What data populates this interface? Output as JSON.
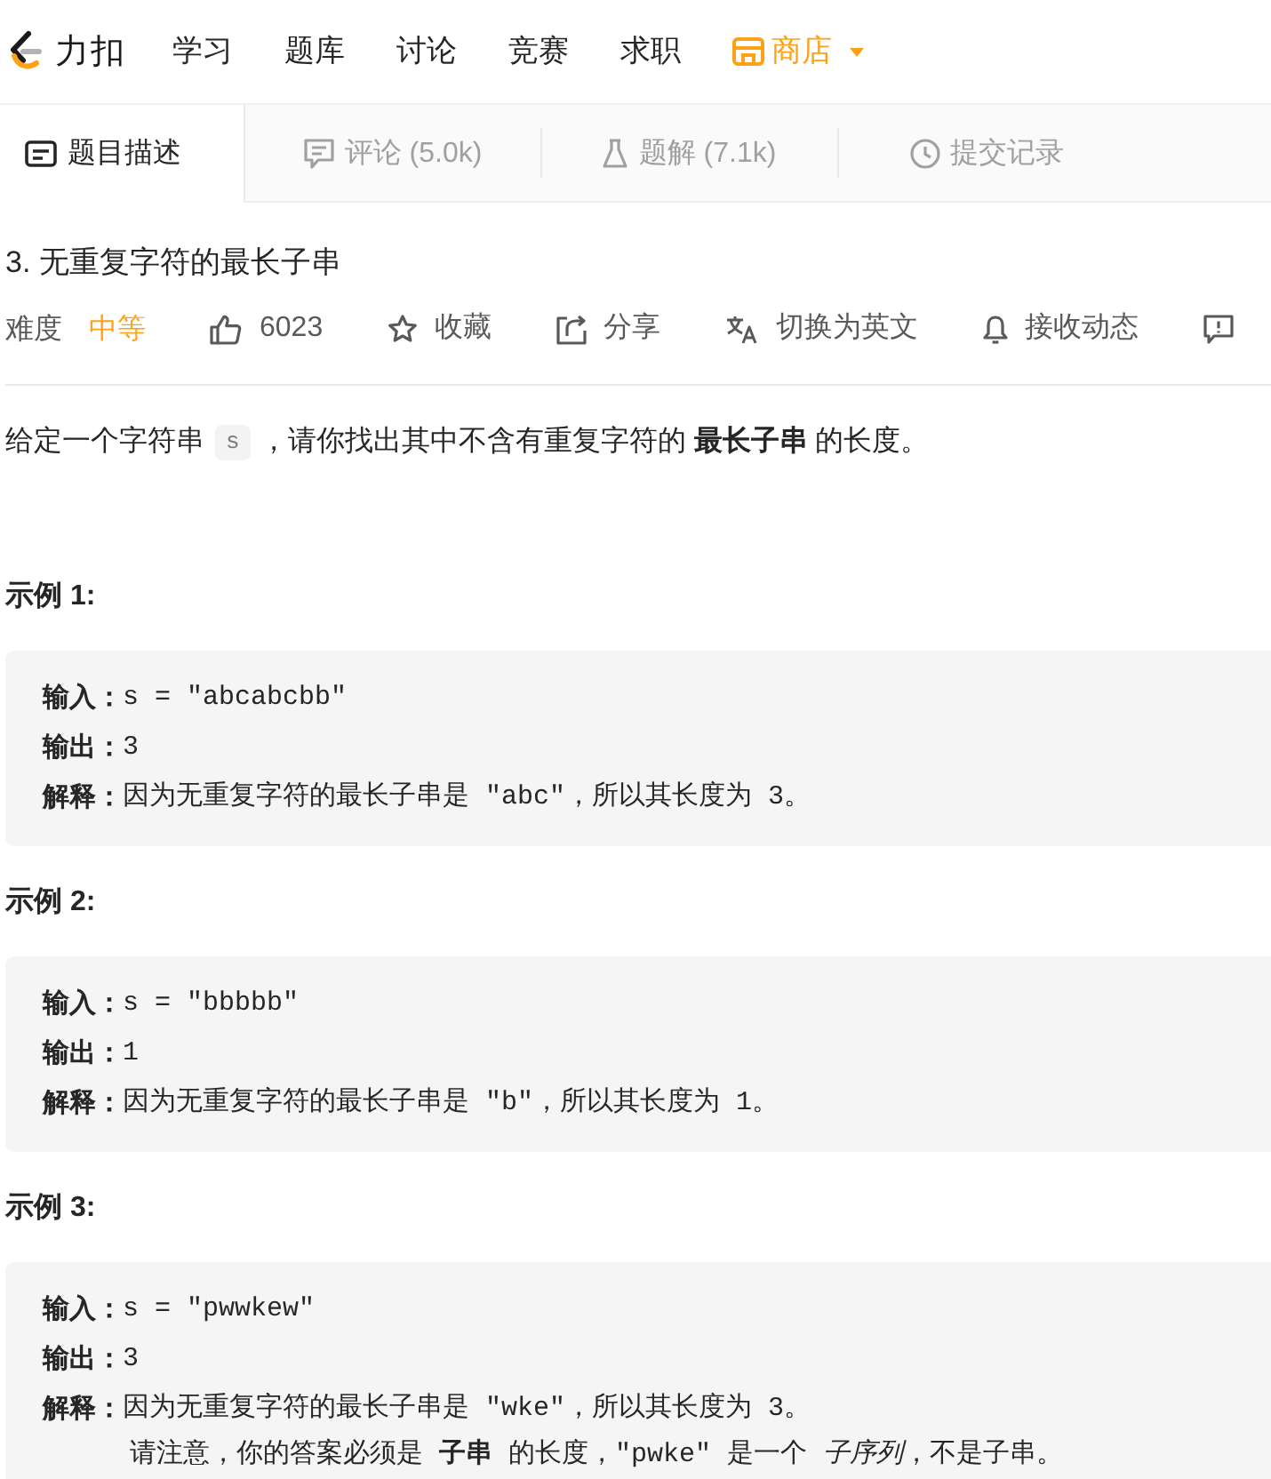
{
  "nav": {
    "brand": "力扣",
    "links": [
      {
        "label": "学习",
        "kind": "link"
      },
      {
        "label": "题库",
        "kind": "link"
      },
      {
        "label": "讨论",
        "kind": "link"
      },
      {
        "label": "竞赛",
        "kind": "link"
      },
      {
        "label": "求职",
        "kind": "link"
      },
      {
        "label": "商店",
        "kind": "store"
      }
    ]
  },
  "tabs": [
    {
      "label": "题目描述",
      "kind": "description",
      "selected": true
    },
    {
      "label": "评论 (5.0k)",
      "kind": "comments",
      "selected": false
    },
    {
      "label": "题解 (7.1k)",
      "kind": "solutions",
      "selected": false
    },
    {
      "label": "提交记录",
      "kind": "submissions",
      "selected": false
    }
  ],
  "problem": {
    "title": "3. 无重复字符的最长子串",
    "difficulty_label": "难度",
    "difficulty": "中等",
    "actions": [
      {
        "kind": "like",
        "label": "6023"
      },
      {
        "kind": "star",
        "label": "收藏"
      },
      {
        "kind": "share",
        "label": "分享"
      },
      {
        "kind": "translate",
        "label": "切换为英文"
      },
      {
        "kind": "bell",
        "label": "接收动态"
      },
      {
        "kind": "feedback"
      }
    ]
  },
  "description": {
    "before": "给定一个字符串",
    "code": "s",
    "after": "，请你找出其中不含有重复字符的 **最长子串** 的长度。"
  },
  "examples": [
    {
      "title": "示例 1:",
      "lines": [
        {
          "kind": "line",
          "label": "输入：",
          "text": "s = \"abcabcbb\""
        },
        {
          "kind": "line",
          "label": "输出：",
          "text": "3"
        },
        {
          "kind": "line",
          "label": "解释：",
          "text": "因为无重复字符的最长子串是 \"abc\"，所以其长度为 3。"
        }
      ]
    },
    {
      "title": "示例 2:",
      "lines": [
        {
          "kind": "line",
          "label": "输入：",
          "text": "s = \"bbbbb\""
        },
        {
          "kind": "line",
          "label": "输出：",
          "text": "1"
        },
        {
          "kind": "line",
          "label": "解释：",
          "text": "因为无重复字符的最长子串是 \"b\"，所以其长度为 1。"
        }
      ]
    },
    {
      "title": "示例 3:",
      "lines": [
        {
          "kind": "line",
          "label": "输入：",
          "text": "s = \"pwwkew\""
        },
        {
          "kind": "line",
          "label": "输出：",
          "text": "3"
        },
        {
          "kind": "line",
          "label": "解释：",
          "text": "因为无重复字符的最长子串是 \"wke\"，所以其长度为 3。"
        },
        {
          "kind": "note",
          "text": "请注意，你的答案必须是 **子串** 的长度，\"pwke\" 是一个 *子序列*，不是子串。"
        }
      ]
    }
  ]
}
